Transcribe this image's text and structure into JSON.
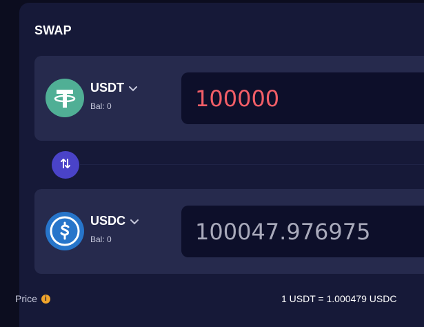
{
  "header": {
    "title": "SWAP"
  },
  "from_token": {
    "symbol": "USDT",
    "balance": "Bal: 0",
    "amount": "100000",
    "icon": "tether-icon",
    "color": "#50af95"
  },
  "to_token": {
    "symbol": "USDC",
    "balance": "Bal: 0",
    "amount": "100047.976975",
    "icon": "usdc-icon",
    "color": "#2775ca"
  },
  "swap_button": {
    "icon": "swap-arrows-icon",
    "color": "#4a43c8"
  },
  "price": {
    "label": "Price",
    "info_glyph": "i",
    "value": "1 USDT = 1.000479 USDC"
  },
  "colors": {
    "background": "#0c0d1f",
    "panel": "#161938",
    "card": "#262a4d",
    "input_bg": "#0d0f2a",
    "from_amount": "#f25e67",
    "to_amount": "#a9aabb",
    "info": "#f0a42b"
  }
}
